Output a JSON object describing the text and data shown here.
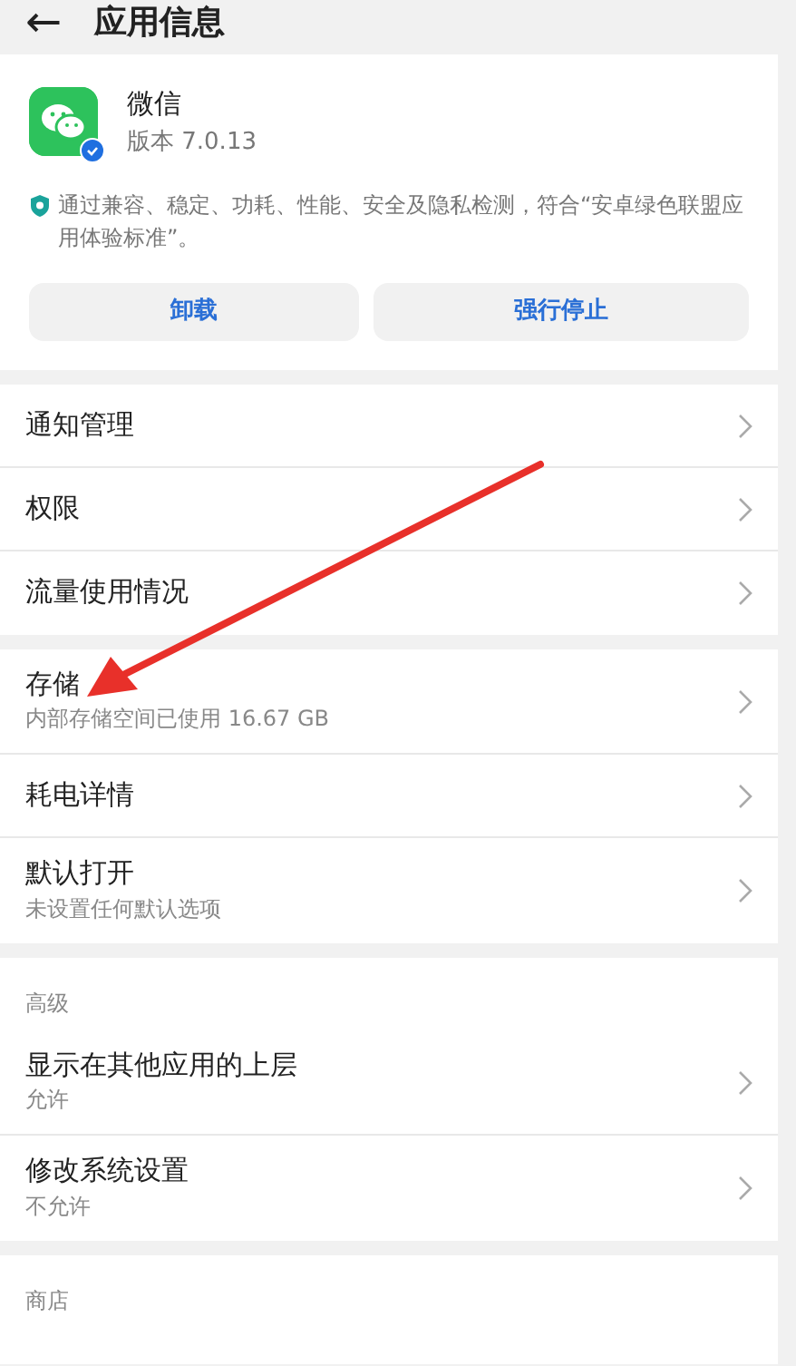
{
  "header": {
    "back": "←",
    "title": "应用信息"
  },
  "app": {
    "name": "微信",
    "version": "版本 7.0.13",
    "verified": true,
    "notice": "通过兼容、稳定、功耗、性能、安全及隐私检测，符合“安卓绿色联盟应用体验标准”。"
  },
  "buttons": [
    {
      "label": "卸载"
    },
    {
      "label": "强行停止"
    }
  ],
  "sections": [
    {
      "items": [
        {
          "title": "通知管理"
        },
        {
          "title": "权限"
        },
        {
          "title": "流量使用情况"
        }
      ]
    },
    {
      "items": [
        {
          "title": "存储",
          "subtitle": "内部存储空间已使用 16.67 GB"
        },
        {
          "title": "耗电详情"
        },
        {
          "title": "默认打开",
          "subtitle": "未设置任何默认选项"
        }
      ]
    },
    {
      "heading": "高级",
      "items": [
        {
          "title": "显示在其他应用的上层",
          "subtitle": "允许"
        },
        {
          "title": "修改系统设置",
          "subtitle": "不允许"
        }
      ]
    },
    {
      "heading": "商店"
    }
  ],
  "annotation": {
    "kind": "arrow"
  }
}
